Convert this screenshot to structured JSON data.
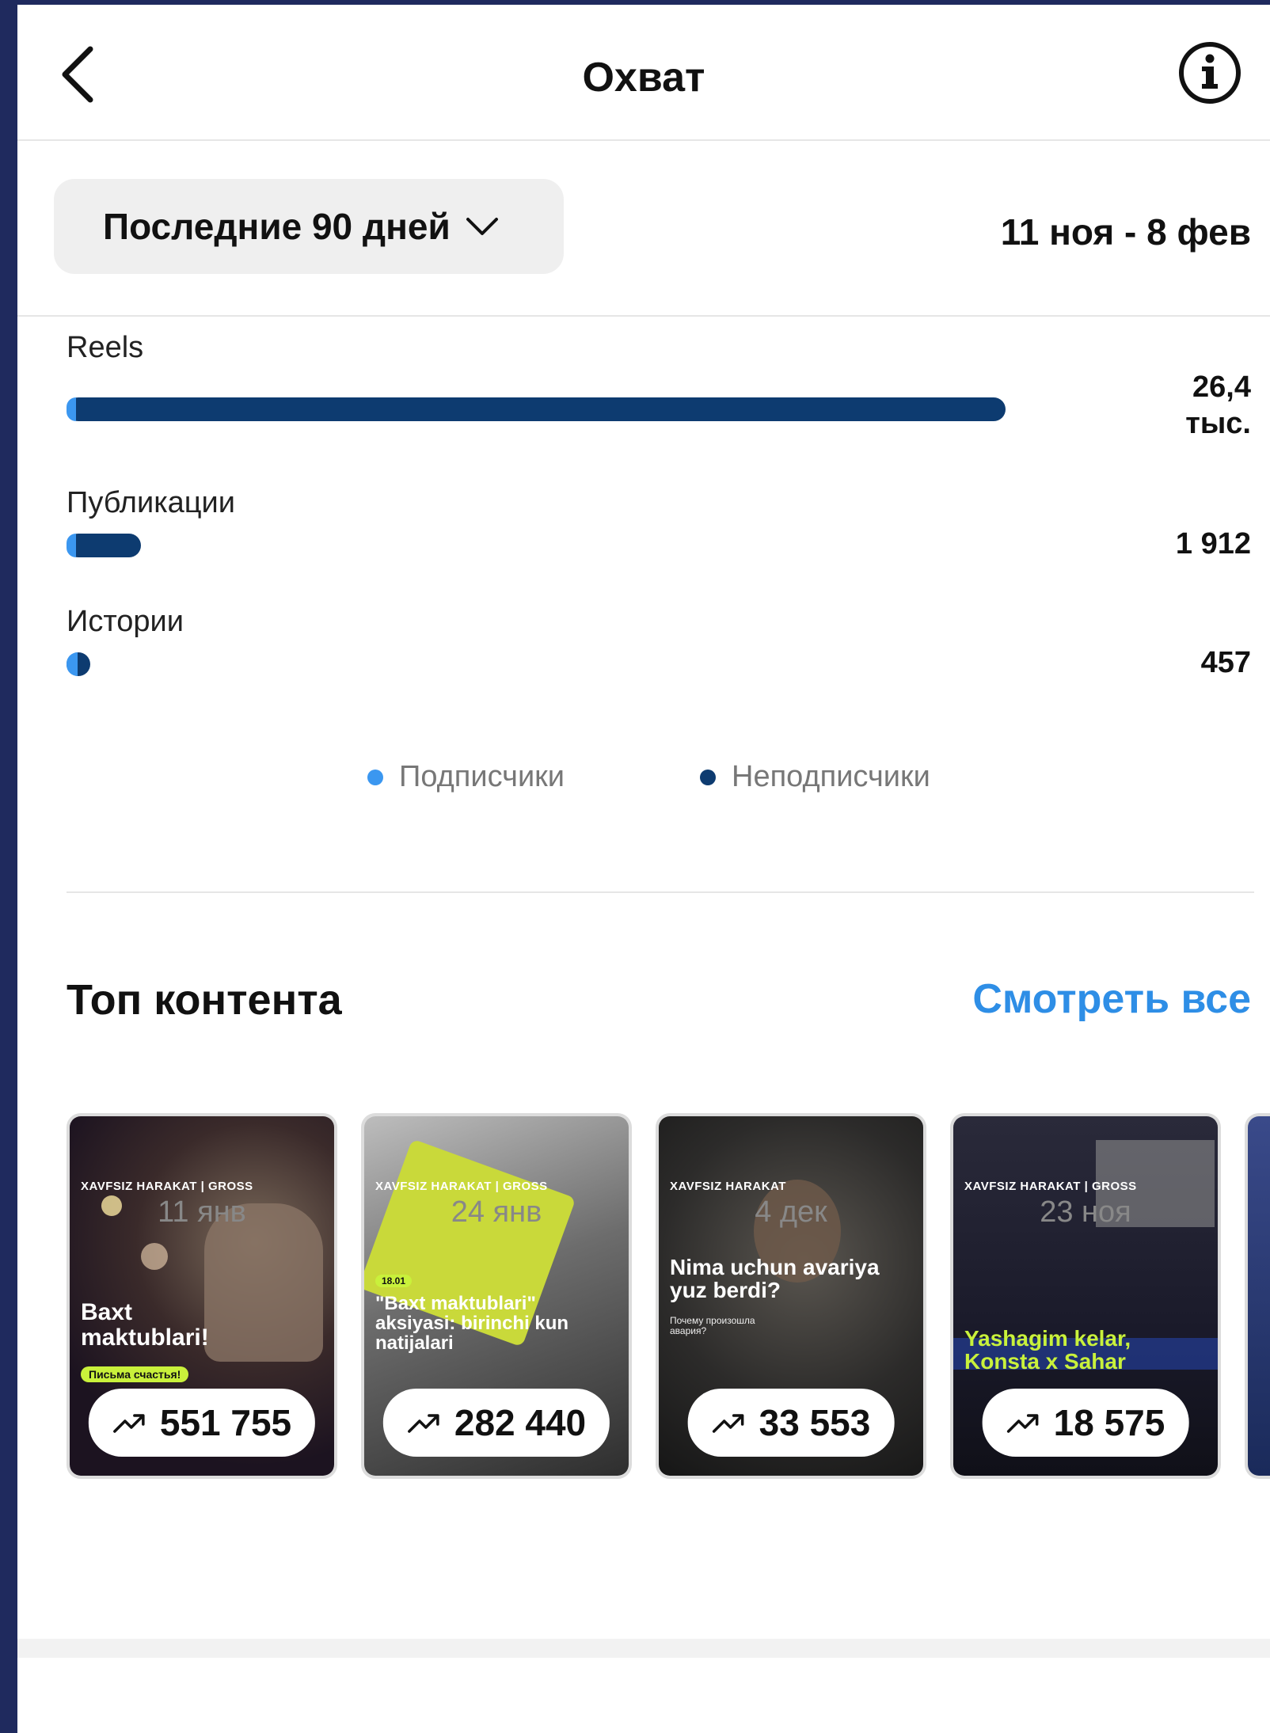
{
  "header": {
    "title": "Охват"
  },
  "period": {
    "button_label": "Последние 90 дней",
    "range": "11 ноя - 8 фев"
  },
  "metrics": [
    {
      "label": "Reels",
      "value_line1": "26,4",
      "value_line2": "тыс.",
      "followers_share": 0.012,
      "relative": 1.0
    },
    {
      "label": "Публикации",
      "value_line1": "1 912",
      "value_line2": "",
      "followers_share": 0.15,
      "relative": 0.0724
    },
    {
      "label": "Истории",
      "value_line1": "457",
      "value_line2": "",
      "followers_share": 0.5,
      "relative": 0.0173
    }
  ],
  "legend": {
    "followers": "Подписчики",
    "non_followers": "Неподписчики"
  },
  "colors": {
    "followers": "#3b97f0",
    "non_followers": "#0d3b70",
    "link": "#2e8ee6"
  },
  "top_content": {
    "title": "Топ контента",
    "see_all": "Смотреть все",
    "items": [
      {
        "value": "551 755",
        "date": "11 янв",
        "logo": "XAVFSIZ HARAKAT | GROSS",
        "caption": "Baxt maktublari!",
        "tag": "Письма счастья!"
      },
      {
        "value": "282 440",
        "date": "24 янв",
        "logo": "XAVFSIZ HARAKAT | GROSS",
        "caption": "\"Baxt maktublari\" aksiyasi: birinchi kun natijalari",
        "tag": "18.01"
      },
      {
        "value": "33 553",
        "date": "4 дек",
        "logo": "XAVFSIZ HARAKAT",
        "caption": "Nima uchun avariya yuz berdi?",
        "tag": "Почему произошла авария?"
      },
      {
        "value": "18 575",
        "date": "23 ноя",
        "logo": "XAVFSIZ HARAKAT | GROSS",
        "caption": "Yashagim kelar, Konsta x Sahar",
        "tag": ""
      }
    ]
  }
}
